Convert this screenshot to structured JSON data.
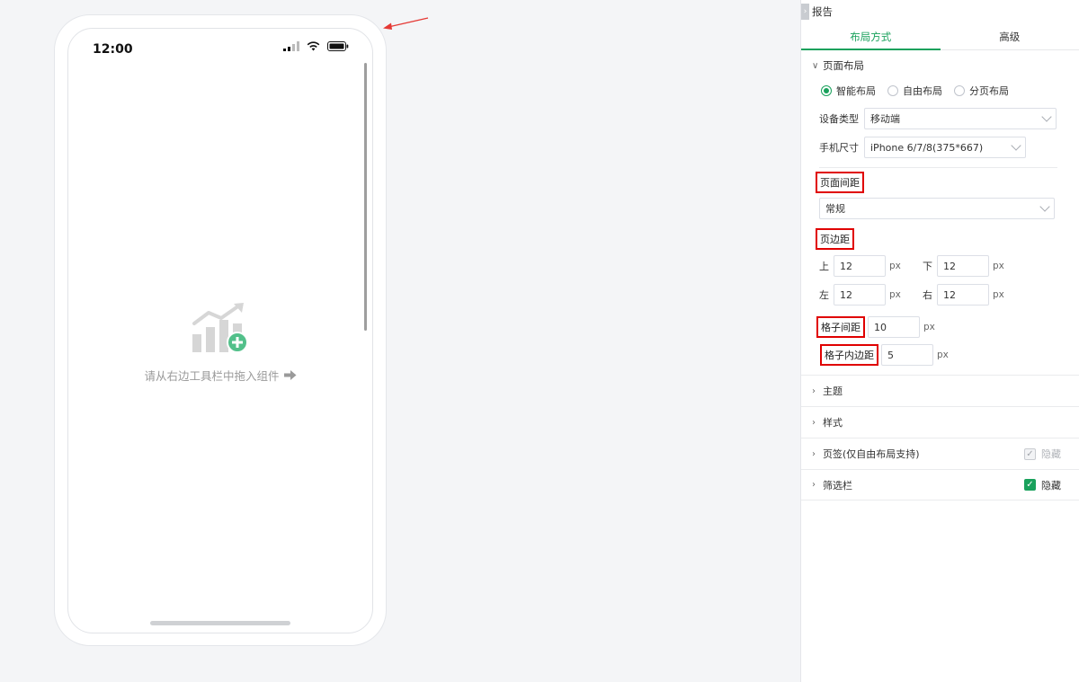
{
  "phone": {
    "time": "12:00",
    "empty_hint": "请从右边工具栏中拖入组件"
  },
  "panel": {
    "title": "报告",
    "tabs": [
      "布局方式",
      "高级"
    ],
    "layout_section": {
      "title": "页面布局",
      "radios": [
        "智能布局",
        "自由布局",
        "分页布局"
      ],
      "selected_radio": "智能布局",
      "device_type_label": "设备类型",
      "device_type_value": "移动端",
      "phone_size_label": "手机尺寸",
      "phone_size_value": "iPhone 6/7/8(375*667)",
      "page_spacing_label": "页面间距",
      "page_spacing_value": "常规",
      "page_margin_label": "页边距",
      "margin": {
        "top_label": "上",
        "top": "12",
        "bottom_label": "下",
        "bottom": "12",
        "left_label": "左",
        "left": "12",
        "right_label": "右",
        "right": "12",
        "unit": "px"
      },
      "grid_gap_label": "格子间距",
      "grid_gap_value": "10",
      "grid_padding_label": "格子内边距",
      "grid_padding_value": "5",
      "unit": "px"
    },
    "theme_label": "主题",
    "style_label": "样式",
    "tabs_label": "页签(仅自由布局支持)",
    "tabs_hide_label": "隐藏",
    "filter_label": "筛选栏",
    "filter_hide_label": "隐藏"
  },
  "colors": {
    "accent": "#19a15c",
    "highlight_box": "#e00000",
    "arrow": "#e53935"
  }
}
